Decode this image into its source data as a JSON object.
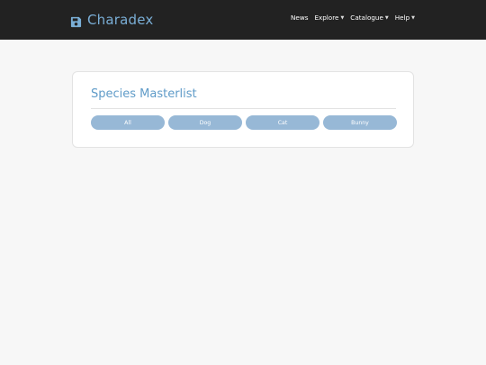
{
  "navbar": {
    "brand_icon": "save-icon",
    "brand_name": "Charadex",
    "items": [
      {
        "label": "News",
        "dropdown": false
      },
      {
        "label": "Explore",
        "dropdown": true
      },
      {
        "label": "Catalogue",
        "dropdown": true
      },
      {
        "label": "Help",
        "dropdown": true
      }
    ]
  },
  "main": {
    "title": "Species Masterlist",
    "filters": [
      "All",
      "Dog",
      "Cat",
      "Bunny"
    ]
  },
  "colors": {
    "navbar_bg": "#222222",
    "brand": "#7aaed6",
    "title": "#5f9bc8",
    "filter_bg": "#97b8d6",
    "page_bg": "#f7f7f7"
  }
}
